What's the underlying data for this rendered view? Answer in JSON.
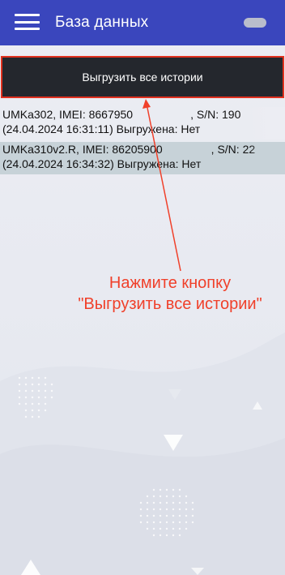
{
  "app_bar": {
    "title": "База данных",
    "menu_icon": "hamburger-menu-icon",
    "toggle_icon": "toggle-pill-icon"
  },
  "upload_all": {
    "label": "Выгрузить все истории"
  },
  "histories": [
    {
      "line1_left": "UMKa302, IMEI: 8667950",
      "line1_right": ", S/N: 190",
      "line2": "(24.04.2024 16:31:11) Выгружена: Нет"
    },
    {
      "line1_left": "UMKa310v2.R, IMEI: 86205900",
      "line1_right": ", S/N: 22",
      "line2": "(24.04.2024 16:34:32) Выгружена: Нет"
    }
  ],
  "annotation": {
    "line1": "Нажмите кнопку",
    "line2": "\"Выгрузить все истории\""
  },
  "colors": {
    "app_bar": "#3a46bd",
    "button_bg": "#24272d",
    "highlight": "#e0301e",
    "annotation": "#f0402a",
    "selected_row": "#c7d2d8"
  }
}
